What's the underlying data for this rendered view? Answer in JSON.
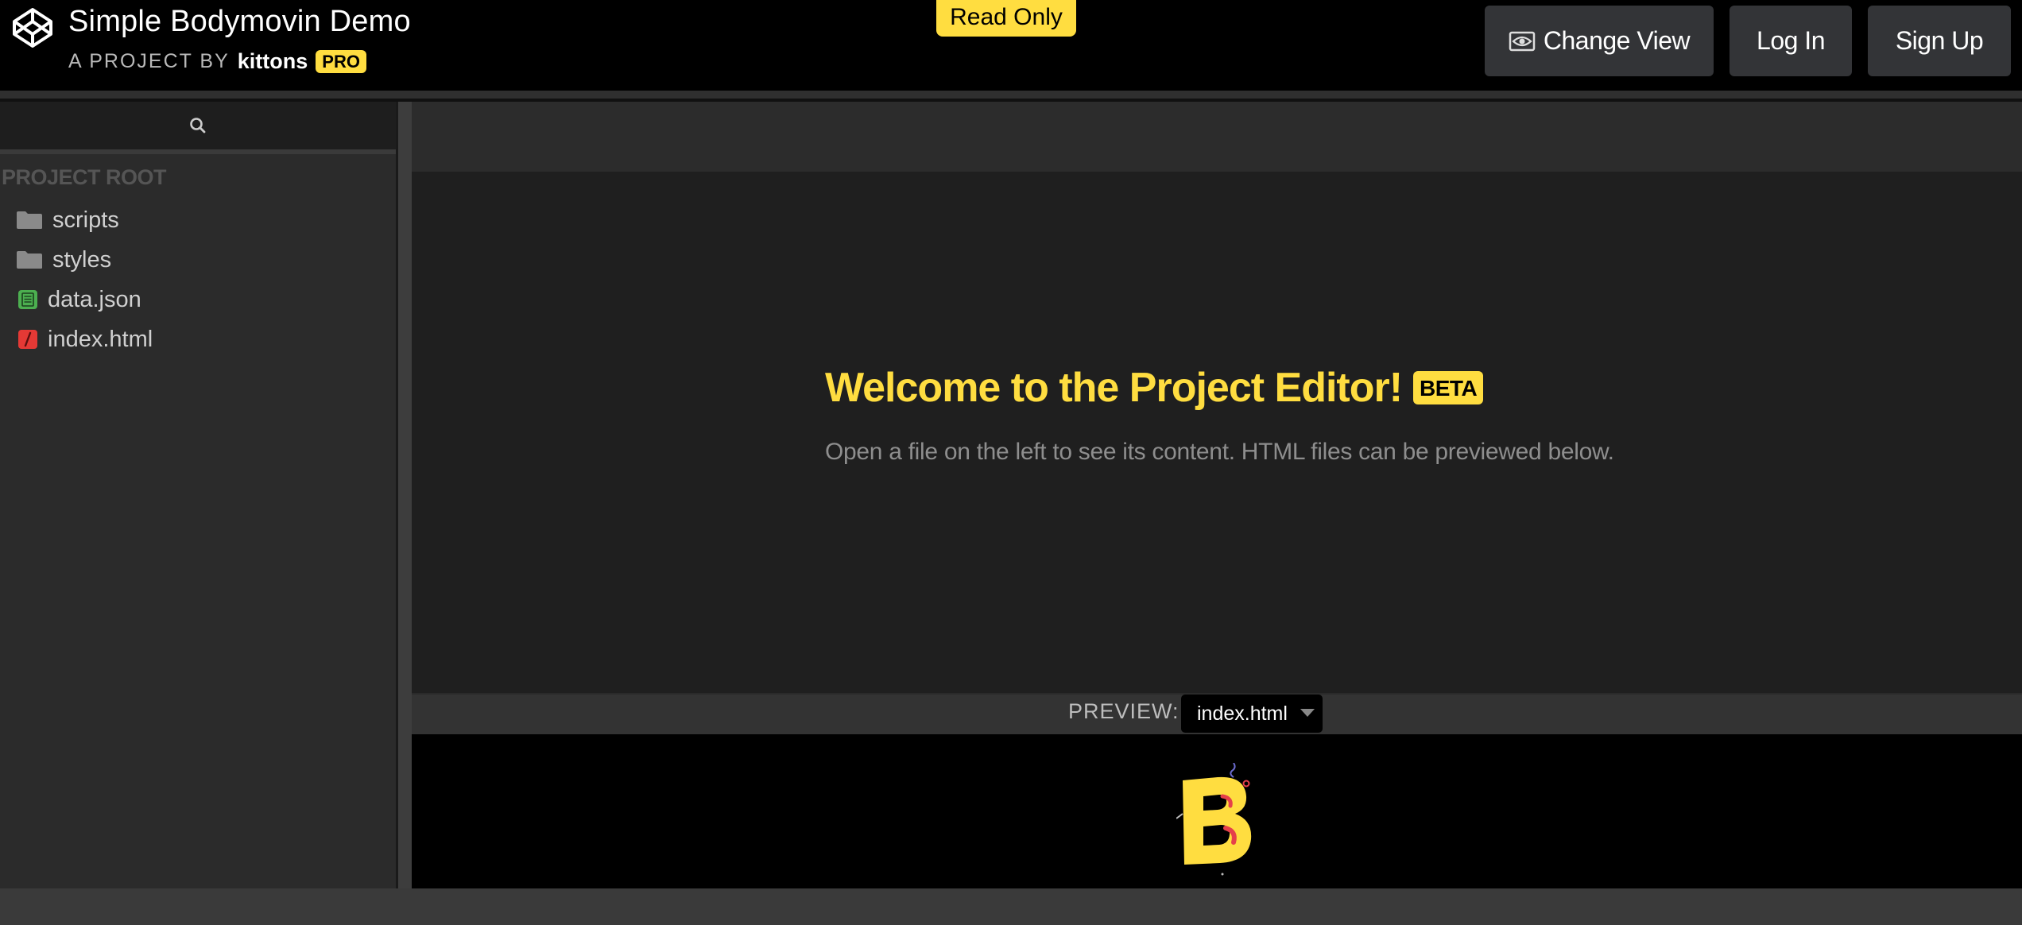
{
  "header": {
    "title": "Simple Bodymovin Demo",
    "byline_prefix": "A PROJECT BY",
    "author": "kittons",
    "author_badge": "PRO",
    "status_tab": "Read Only",
    "buttons": {
      "change_view": "Change View",
      "log_in": "Log In",
      "sign_up": "Sign Up"
    }
  },
  "sidebar": {
    "root_label": "PROJECT ROOT",
    "items": [
      {
        "label": "scripts",
        "type": "folder",
        "icon": "folder-icon"
      },
      {
        "label": "styles",
        "type": "folder",
        "icon": "folder-icon"
      },
      {
        "label": "data.json",
        "type": "file",
        "icon": "json-file-icon"
      },
      {
        "label": "index.html",
        "type": "file",
        "icon": "html-file-icon"
      }
    ]
  },
  "main": {
    "welcome_title": "Welcome to the Project Editor!",
    "welcome_badge": "BETA",
    "welcome_subtitle": "Open a file on the left to see its content. HTML files can be previewed below."
  },
  "preview": {
    "label": "PREVIEW:",
    "selected_file": "index.html"
  },
  "colors": {
    "accent": "#ffdd40",
    "background": "#000000",
    "sidebar": "#2b2b2b",
    "editor": "#1f1f1f",
    "json_icon": "#4caf50",
    "html_icon": "#e53935"
  }
}
